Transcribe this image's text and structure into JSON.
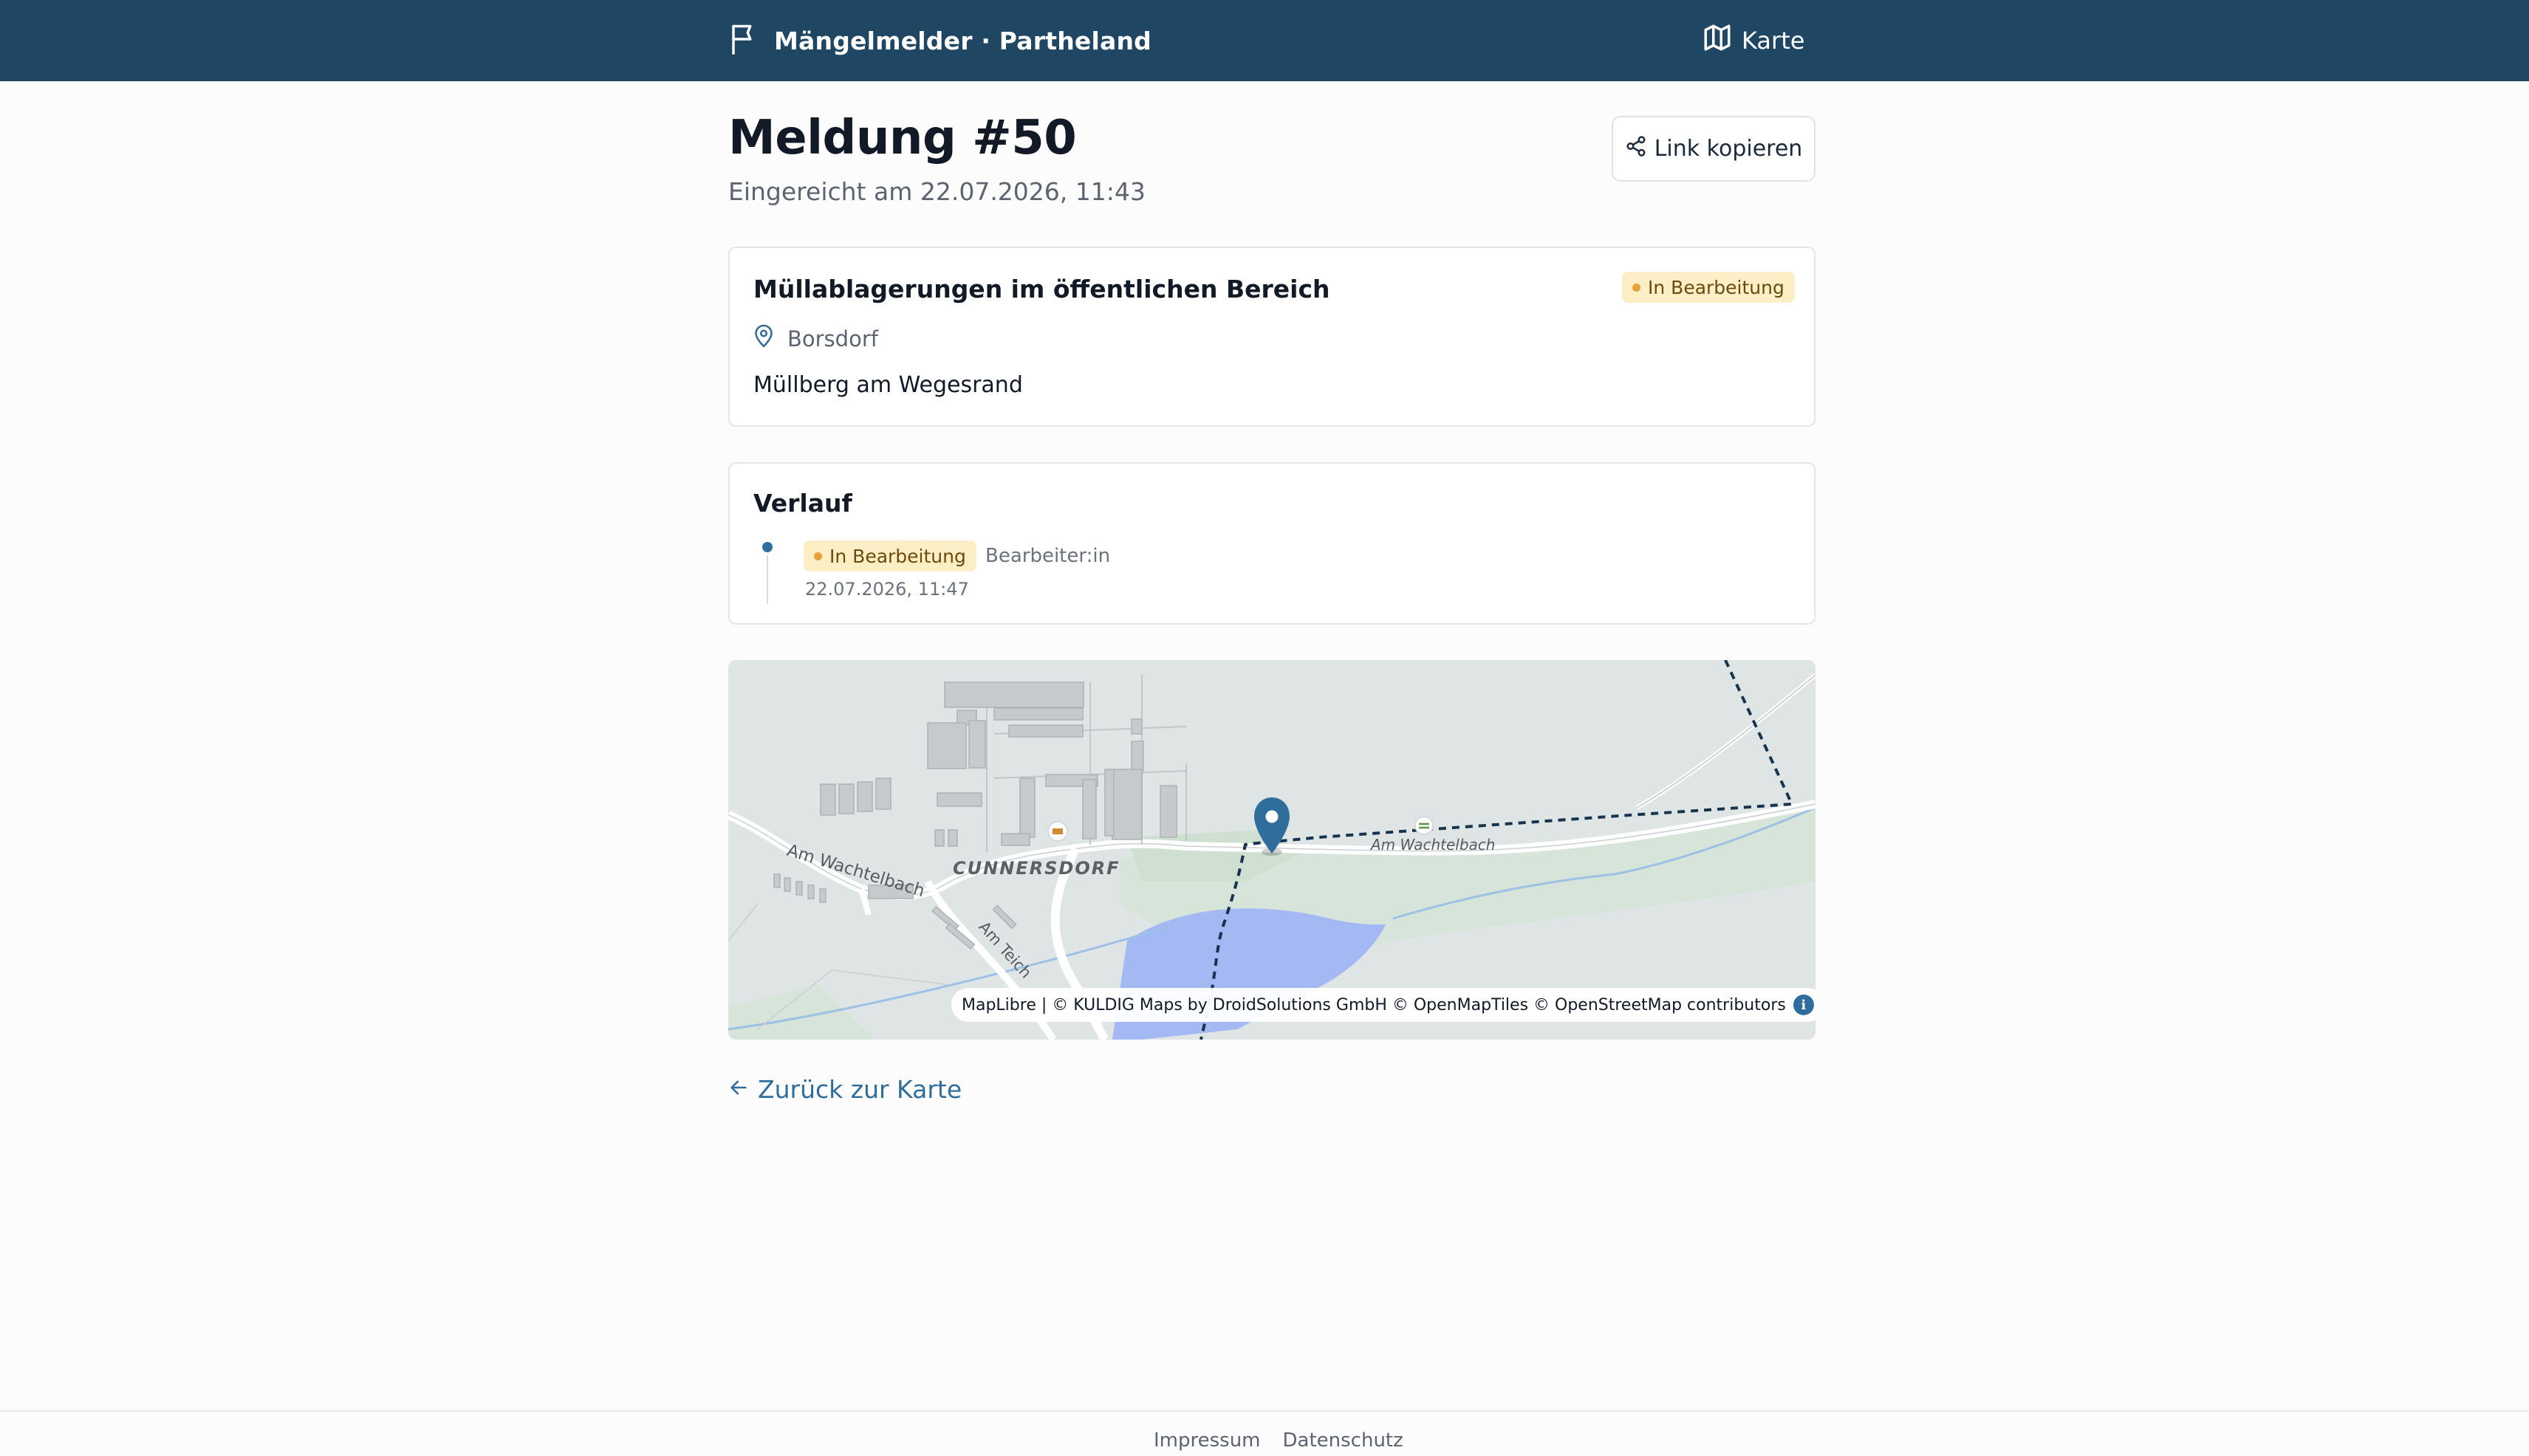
{
  "header": {
    "brand": "Mängelmelder · Partheland",
    "map_link": "Karte"
  },
  "page": {
    "title": "Meldung #50",
    "submitted": "Eingereicht am 22.07.2026, 11:43",
    "copy_link": "Link kopieren"
  },
  "report": {
    "category": "Müllablagerungen im öffentlichen Bereich",
    "status": "In Bearbeitung",
    "location": "Borsdorf",
    "description": "Müllberg am Wegesrand"
  },
  "history": {
    "title": "Verlauf",
    "entries": [
      {
        "status": "In Bearbeitung",
        "actor": "Bearbeiter:in",
        "time": "22.07.2026, 11:47"
      }
    ]
  },
  "map": {
    "labels": {
      "district": "CUNNERSDORF",
      "street_west": "Am Wachtelbach",
      "street_east": "Am Wachtelbach",
      "street_south": "Am Teich"
    },
    "attribution": "MapLibre | © KULDIG Maps by DroidSolutions GmbH © OpenMapTiles © OpenStreetMap contributors",
    "info_glyph": "i"
  },
  "back_link": "Zurück zur Karte",
  "footer": {
    "imprint": "Impressum",
    "privacy": "Datenschutz"
  },
  "colors": {
    "header_bg": "#1f4662",
    "accent": "#2f6e9c",
    "badge_bg": "#fcefc6",
    "badge_dot": "#e8a23a",
    "water": "#a4b9f4"
  },
  "icons": {
    "brand": "flag-icon",
    "map_link": "map-icon",
    "copy": "share-icon",
    "location": "map-pin-icon",
    "back": "arrow-left-icon"
  }
}
